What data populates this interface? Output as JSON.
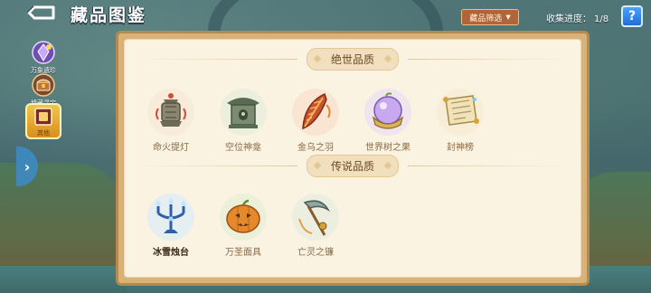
{
  "header": {
    "title": "藏品图鉴",
    "filter_label": "藏品筛选",
    "progress_label": "收集进度：",
    "progress_value": "1/8",
    "help_label": "?"
  },
  "sidebar": {
    "items": [
      {
        "label": "万象遗珍",
        "icon": "crystal-icon",
        "active": false
      },
      {
        "label": "墟藏寻宝",
        "icon": "treasure-chest-icon",
        "active": false
      },
      {
        "label": "其他",
        "icon": "frame-icon",
        "active": true
      }
    ]
  },
  "sections": [
    {
      "title": "绝世品质",
      "items": [
        {
          "name": "命火提灯",
          "icon": "lantern-icon",
          "owned": false
        },
        {
          "name": "空位神龛",
          "icon": "shrine-icon",
          "owned": false
        },
        {
          "name": "金乌之羽",
          "icon": "feather-icon",
          "owned": false
        },
        {
          "name": "世界树之果",
          "icon": "fruit-icon",
          "owned": false
        },
        {
          "name": "封神榜",
          "icon": "scroll-icon",
          "owned": false
        }
      ]
    },
    {
      "title": "传说品质",
      "items": [
        {
          "name": "冰雪烛台",
          "icon": "candelabra-icon",
          "owned": true
        },
        {
          "name": "万圣面具",
          "icon": "pumpkin-mask-icon",
          "owned": false
        },
        {
          "name": "亡灵之镰",
          "icon": "scythe-icon",
          "owned": false
        }
      ]
    }
  ],
  "colors": {
    "panel_border": "#b58a4e",
    "panel_bg": "#fbf3e1",
    "accent_orange": "#b0643a",
    "help_blue": "#1f6fd6",
    "active_tab": "#f3c54a"
  }
}
